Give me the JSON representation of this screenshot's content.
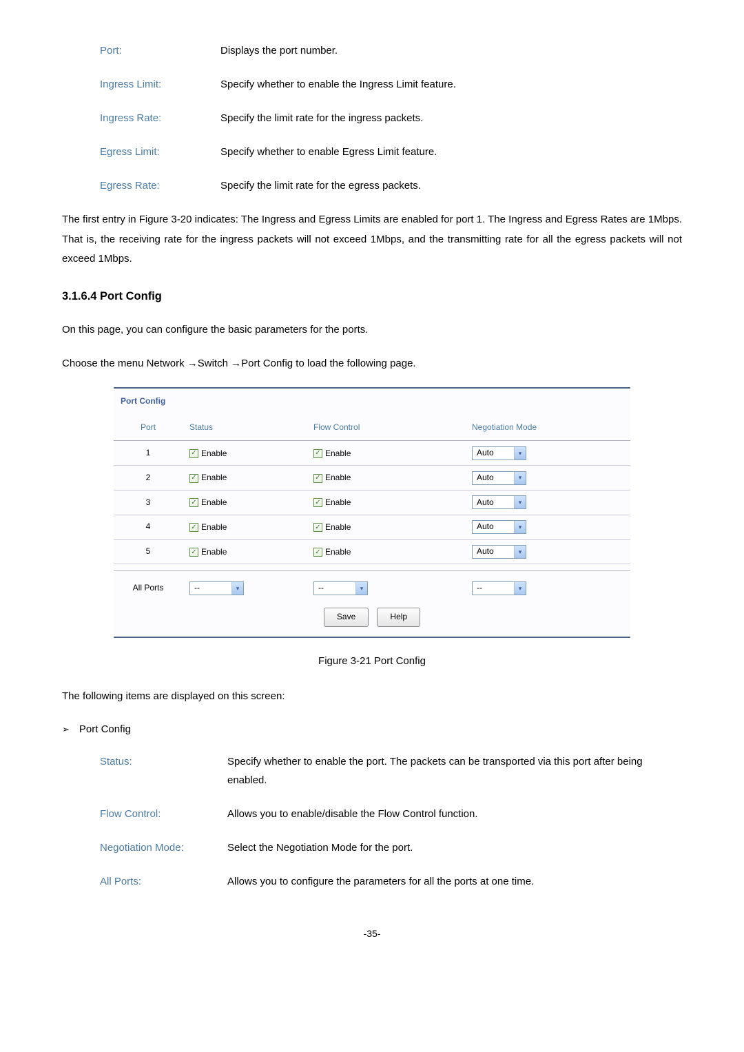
{
  "defs1": {
    "port_label": "Port:",
    "port_desc": "Displays the port number.",
    "ingress_limit_label": "Ingress Limit:",
    "ingress_limit_desc": "Specify whether to enable the Ingress Limit feature.",
    "ingress_rate_label": "Ingress Rate:",
    "ingress_rate_desc": "Specify the limit rate for the ingress packets.",
    "egress_limit_label": "Egress Limit:",
    "egress_limit_desc": "Specify whether to enable Egress Limit feature.",
    "egress_rate_label": "Egress Rate:",
    "egress_rate_desc": "Specify the limit rate for the egress packets."
  },
  "para1": "The first entry in Figure 3-20 indicates: The Ingress and Egress Limits are enabled for port 1. The Ingress and Egress Rates are 1Mbps. That is, the receiving rate for the ingress packets will not exceed 1Mbps, and the transmitting rate for all the egress packets will not exceed 1Mbps.",
  "heading": "3.1.6.4     Port Config",
  "para2": "On this page, you can configure the basic parameters for the ports.",
  "para3": "Choose the menu Network →Switch →Port Config   to load the following page.",
  "figure": {
    "title": "Port Config",
    "th_port": "Port",
    "th_status": "Status",
    "th_flow": "Flow Control",
    "th_neg": "Negotiation Mode",
    "rows": [
      {
        "port": "1",
        "status": "Enable",
        "flow": "Enable",
        "neg": "Auto"
      },
      {
        "port": "2",
        "status": "Enable",
        "flow": "Enable",
        "neg": "Auto"
      },
      {
        "port": "3",
        "status": "Enable",
        "flow": "Enable",
        "neg": "Auto"
      },
      {
        "port": "4",
        "status": "Enable",
        "flow": "Enable",
        "neg": "Auto"
      },
      {
        "port": "5",
        "status": "Enable",
        "flow": "Enable",
        "neg": "Auto"
      }
    ],
    "all_ports_label": "All Ports",
    "all_val": "--",
    "btn_save": "Save",
    "btn_help": "Help"
  },
  "figure_caption": "Figure 3-21 Port Config",
  "para4": "The following items are displayed on this screen:",
  "bullet_label": "Port Config",
  "defs2": {
    "status_label": "Status:",
    "status_desc": "Specify whether to enable the port. The packets can be transported via this port after being enabled.",
    "flow_label": "Flow Control:",
    "flow_desc": "Allows you to enable/disable the Flow Control function.",
    "neg_label": "Negotiation Mode:",
    "neg_desc": "Select the Negotiation Mode for the port.",
    "all_label": "All Ports:",
    "all_desc": "Allows you to configure the parameters for all the ports at one time."
  },
  "page_num": "-35-"
}
